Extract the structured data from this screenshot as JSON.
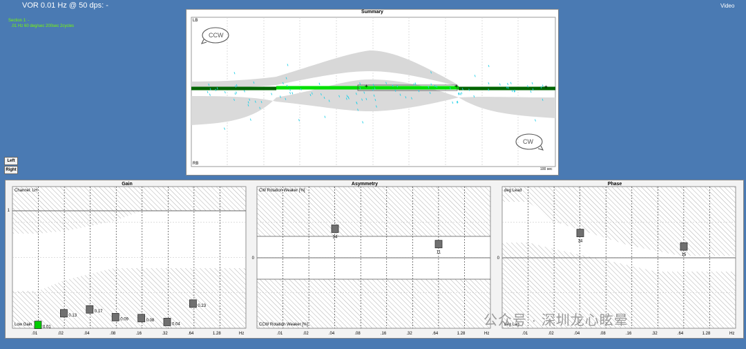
{
  "header": {
    "title": "VOR 0.01 Hz @ 50 dps: -",
    "video_label": "Video"
  },
  "section_info": {
    "line1": "Section 1: -",
    "line2": ".01 Hz  60 deg/sec  200sec  2cycles"
  },
  "side_buttons": {
    "left": "Left",
    "right": "Right"
  },
  "summary": {
    "title": "Summary",
    "top_label": "LB",
    "bottom_label": "RB",
    "ccw_label": "CCW",
    "cw_label": "CW",
    "time_label": "100 sec"
  },
  "colors": {
    "background": "#4a7ab3",
    "trace_green": "#00e000",
    "trace_dark_green": "#006400",
    "scatter_cyan": "#20d0e8",
    "normal_band_gray": "#d8d8d8",
    "data_marker": "#707070",
    "highlight_marker": "#00cc00"
  },
  "watermark": "公众号 · 深圳龙心眩晕",
  "chart_data": [
    {
      "type": "scatter",
      "title": "Gain",
      "ylabel_top": "Channel: LH",
      "ylabel_bottom": "Low Gain",
      "y_tick": "1",
      "x_unit": "Hz",
      "x_ticks": [
        ".01",
        ".02",
        ".04",
        ".08",
        ".16",
        ".32",
        ".64",
        "1.28"
      ],
      "points": [
        {
          "x": 0.01,
          "y": 0.01,
          "label": "0.01",
          "highlight": true
        },
        {
          "x": 0.02,
          "y": 0.13,
          "label": "0.13"
        },
        {
          "x": 0.04,
          "y": 0.17,
          "label": "0.17"
        },
        {
          "x": 0.08,
          "y": 0.09,
          "label": "0.09"
        },
        {
          "x": 0.16,
          "y": 0.08,
          "label": "0.08"
        },
        {
          "x": 0.32,
          "y": 0.04,
          "label": "0.04"
        },
        {
          "x": 0.64,
          "y": 0.23,
          "label": "0.23"
        }
      ]
    },
    {
      "type": "scatter",
      "title": "Asymmetry",
      "ylabel_top": "CW Rotation Weaker [%]",
      "ylabel_bottom": "CCW Rotation Weaker [%]",
      "y_tick": "0",
      "x_unit": "Hz",
      "x_ticks": [
        ".01",
        ".02",
        ".04",
        ".08",
        ".16",
        ".32",
        ".64",
        "1.28"
      ],
      "points": [
        {
          "x": 0.04,
          "y": 24,
          "label": "24"
        },
        {
          "x": 0.64,
          "y": 11,
          "label": "11"
        }
      ]
    },
    {
      "type": "scatter",
      "title": "Phase",
      "ylabel_top": "deg Lead",
      "ylabel_bottom": "deg Lag",
      "y_tick": "0",
      "x_unit": "Hz",
      "x_ticks": [
        ".01",
        ".02",
        ".04",
        ".08",
        ".16",
        ".32",
        ".64",
        "1.28"
      ],
      "points": [
        {
          "x": 0.04,
          "y": 34,
          "label": "34"
        },
        {
          "x": 0.64,
          "y": 15,
          "label": "15"
        }
      ]
    }
  ]
}
